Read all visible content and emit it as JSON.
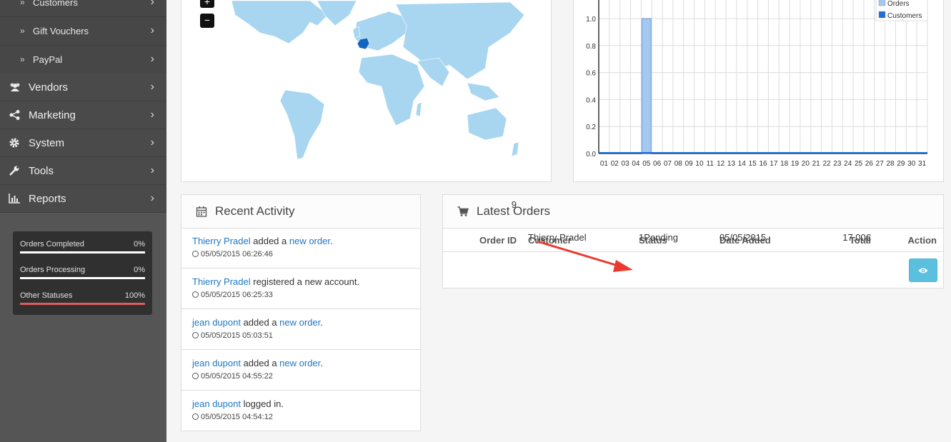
{
  "sidebar": {
    "sub_items": [
      {
        "label": "Customers"
      },
      {
        "label": "Gift Vouchers"
      },
      {
        "label": "PayPal"
      }
    ],
    "nav_items": [
      {
        "label": "Vendors",
        "icon": "users-icon"
      },
      {
        "label": "Marketing",
        "icon": "share-icon"
      },
      {
        "label": "System",
        "icon": "gear-icon"
      },
      {
        "label": "Tools",
        "icon": "wrench-icon"
      },
      {
        "label": "Reports",
        "icon": "bar-chart-icon"
      }
    ],
    "stats": [
      {
        "label": "Orders Completed",
        "value": "0%",
        "fraction": 0,
        "color": "#ffffff"
      },
      {
        "label": "Orders Processing",
        "value": "0%",
        "fraction": 0,
        "color": "#ffffff"
      },
      {
        "label": "Other Statuses",
        "value": "100%",
        "fraction": 1,
        "color": "#e05d5d"
      }
    ]
  },
  "map": {
    "zoom_in": "+",
    "zoom_out": "−",
    "highlight_color": "#1565c0",
    "land_color": "#a8d6f0"
  },
  "chart_data": {
    "type": "bar",
    "categories": [
      "01",
      "02",
      "03",
      "04",
      "05",
      "06",
      "07",
      "08",
      "09",
      "10",
      "11",
      "12",
      "13",
      "14",
      "15",
      "16",
      "17",
      "18",
      "19",
      "20",
      "21",
      "22",
      "23",
      "24",
      "25",
      "26",
      "27",
      "28",
      "29",
      "30",
      "31"
    ],
    "series": [
      {
        "name": "Orders",
        "values": [
          0,
          0,
          0,
          0,
          1,
          0,
          0,
          0,
          0,
          0,
          0,
          0,
          0,
          0,
          0,
          0,
          0,
          0,
          0,
          0,
          0,
          0,
          0,
          0,
          0,
          0,
          0,
          0,
          0,
          0,
          0
        ],
        "color": "#a5c8f0"
      },
      {
        "name": "Customers",
        "values": [
          0,
          0,
          0,
          0,
          0,
          0,
          0,
          0,
          0,
          0,
          0,
          0,
          0,
          0,
          0,
          0,
          0,
          0,
          0,
          0,
          0,
          0,
          0,
          0,
          0,
          0,
          0,
          0,
          0,
          0,
          0
        ],
        "color": "#1e6fd6"
      }
    ],
    "y_ticks": [
      "0.0",
      "0.2",
      "0.4",
      "0.6",
      "0.8",
      "1.0"
    ],
    "ylim": [
      0,
      1.0
    ],
    "grid": true,
    "legend": "top-right"
  },
  "activity": {
    "title": "Recent Activity",
    "items": [
      {
        "user": "Thierry Pradel",
        "text1": " added a ",
        "link": "new order",
        "text2": ".",
        "time": "05/05/2015 06:26:46"
      },
      {
        "user": "Thierry Pradel",
        "text1": " registered a new account.",
        "link": "",
        "text2": "",
        "time": "05/05/2015 06:25:33"
      },
      {
        "user": "jean dupont",
        "text1": " added a ",
        "link": "new order",
        "text2": ".",
        "time": "05/05/2015 05:03:51"
      },
      {
        "user": "jean dupont",
        "text1": " added a ",
        "link": "new order",
        "text2": ".",
        "time": "05/05/2015 04:55:22"
      },
      {
        "user": "jean dupont",
        "text1": " logged in.",
        "link": "",
        "text2": "",
        "time": "05/05/2015 04:54:12"
      }
    ]
  },
  "orders": {
    "title": "Latest Orders",
    "columns": {
      "id": "Order ID",
      "customer": "Customer",
      "status": "Status",
      "date": "Date Added",
      "total": "Total",
      "action": "Action"
    },
    "rows": [
      {
        "id": "9",
        "customer": "Thierry Pradel",
        "status": "1Pending",
        "date": "05/05/2015",
        "total": "17.00€"
      }
    ]
  }
}
